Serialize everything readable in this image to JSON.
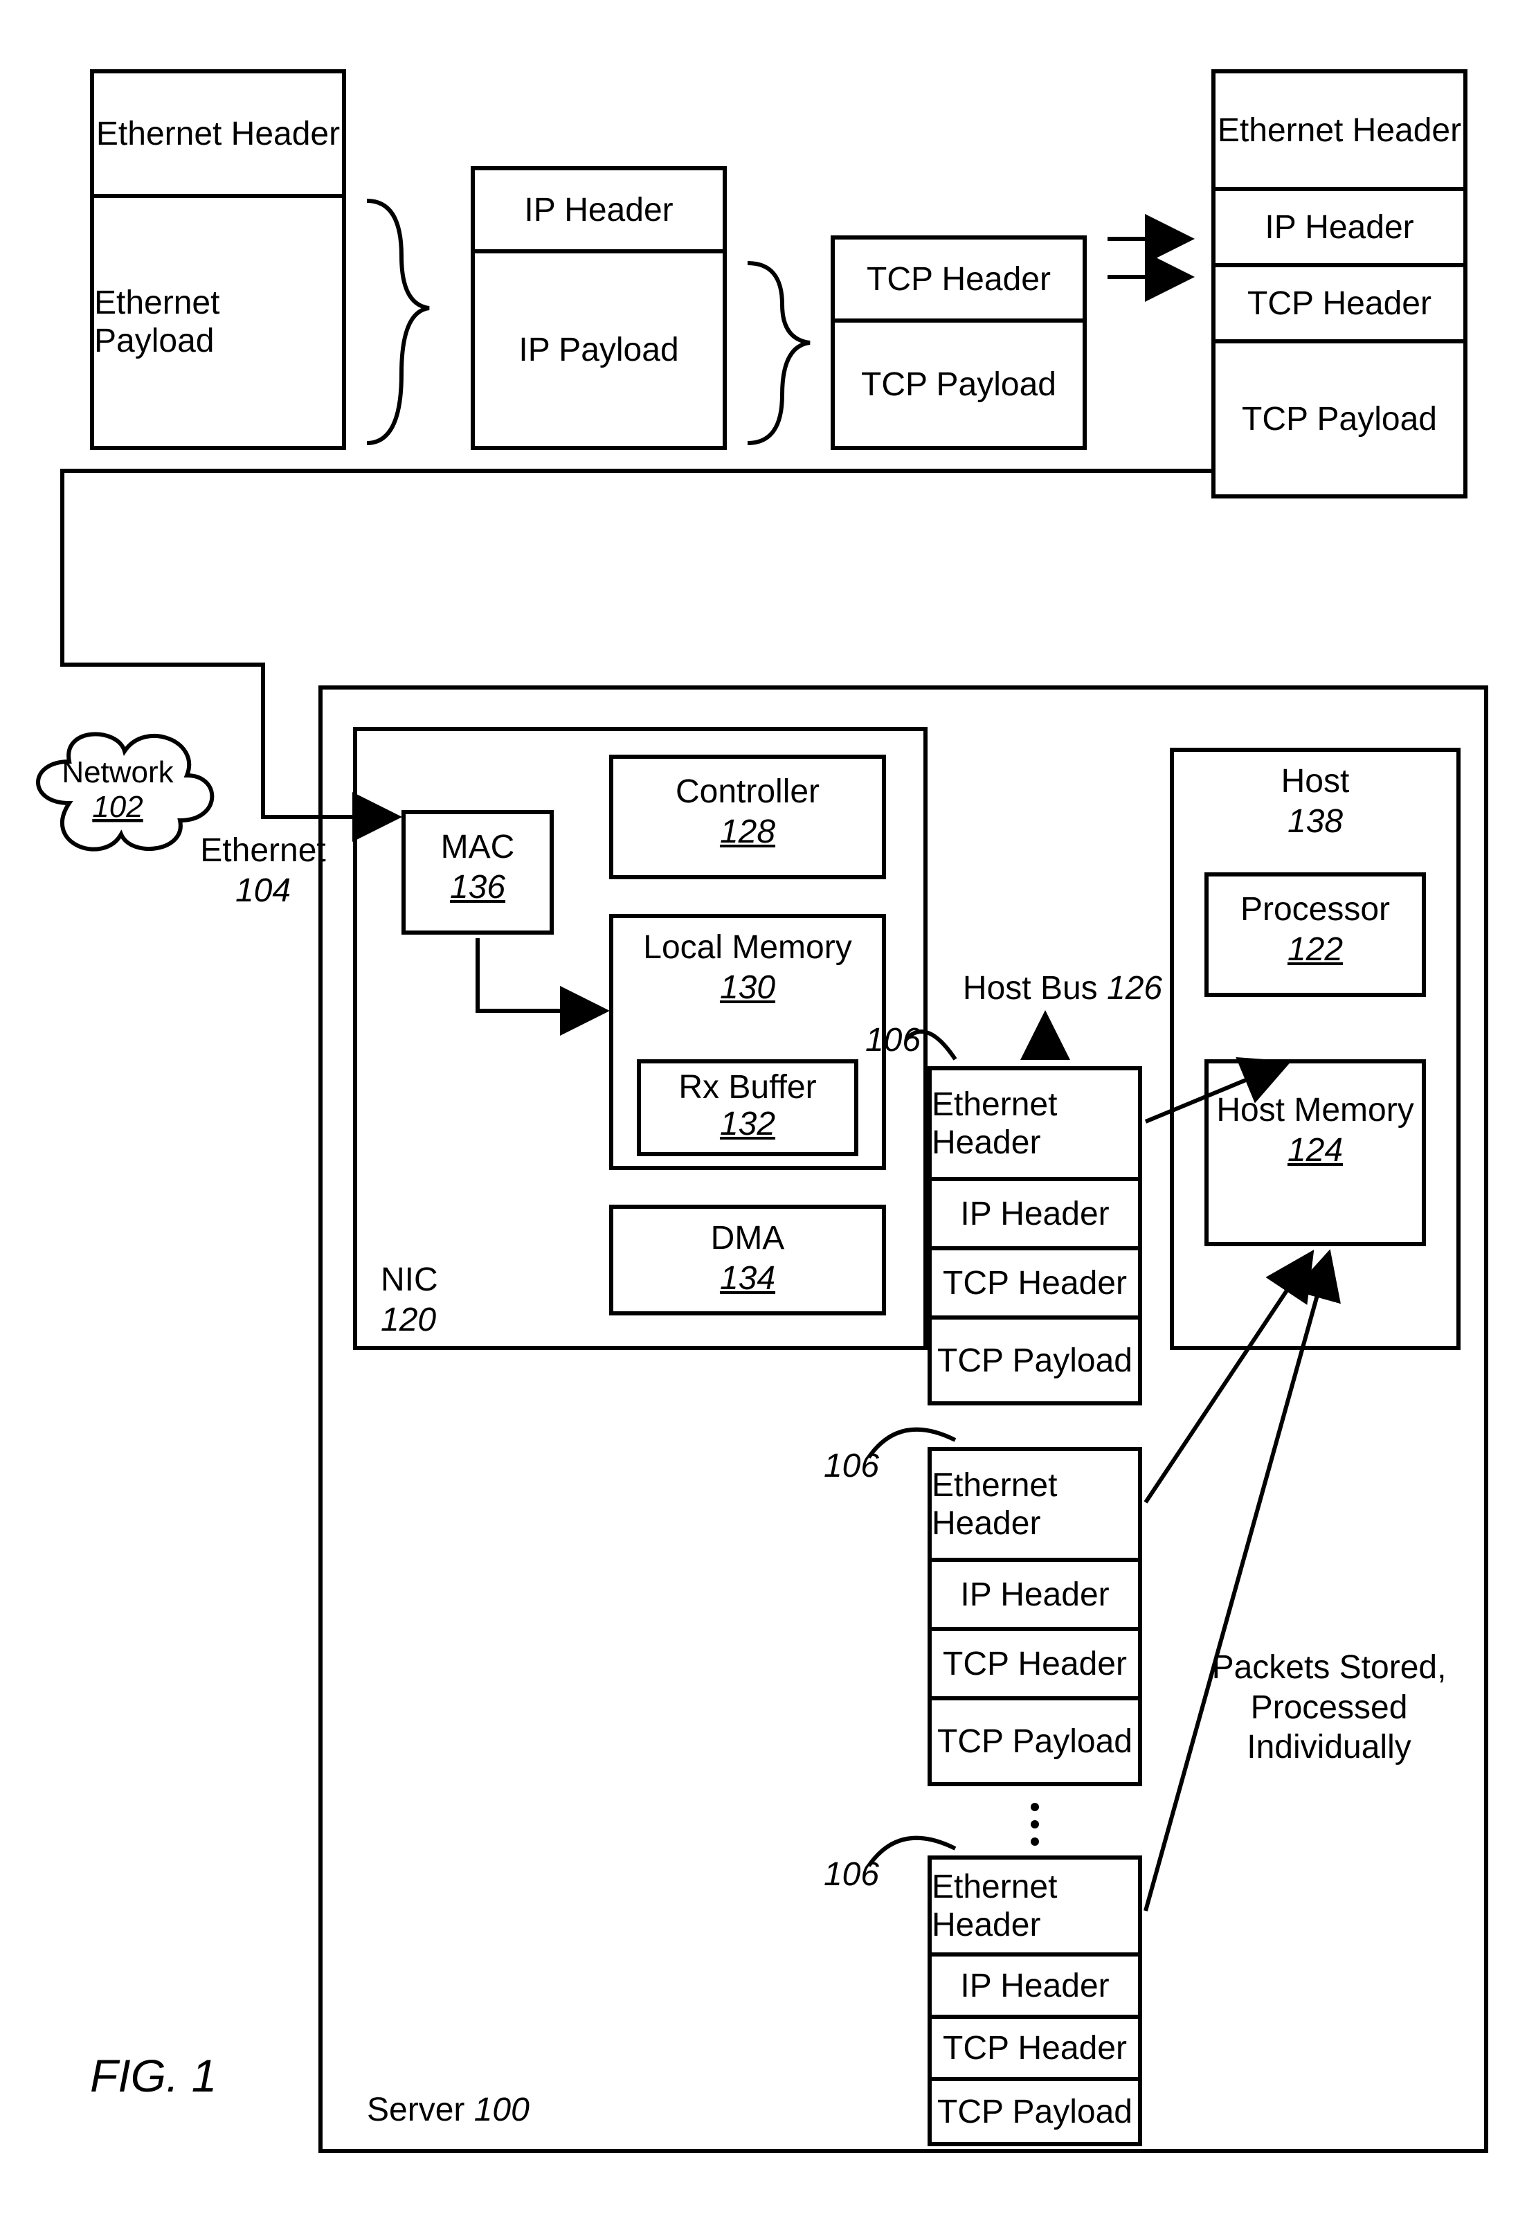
{
  "figure_label": "FIG. 1",
  "ethernet_box": {
    "header": "Ethernet Header",
    "payload": "Ethernet Payload"
  },
  "ip_box": {
    "header": "IP Header",
    "payload": "IP Payload"
  },
  "tcp_box": {
    "header": "TCP Header",
    "payload": "TCP Payload"
  },
  "combined_box": {
    "eth": "Ethernet Header",
    "ip": "IP Header",
    "tcp": "TCP Header",
    "payload": "TCP Payload"
  },
  "network": {
    "label": "Network",
    "num": "102"
  },
  "ethernet_link": {
    "label": "Ethernet",
    "num": "104"
  },
  "server": {
    "label": "Server",
    "num": "100"
  },
  "nic": {
    "label": "NIC",
    "num": "120"
  },
  "mac": {
    "label": "MAC",
    "num": "136"
  },
  "controller": {
    "label": "Controller",
    "num": "128"
  },
  "local_memory": {
    "label": "Local Memory",
    "num": "130"
  },
  "rx_buffer": {
    "label": "Rx Buffer",
    "num": "132"
  },
  "dma": {
    "label": "DMA",
    "num": "134"
  },
  "host": {
    "label": "Host",
    "num": "138"
  },
  "processor": {
    "label": "Processor",
    "num": "122"
  },
  "host_memory": {
    "label": "Host Memory",
    "num": "124"
  },
  "host_bus": {
    "label": "Host Bus",
    "num": "126"
  },
  "packet_label": "106",
  "packets_note": {
    "line1": "Packets Stored,",
    "line2": "Processed",
    "line3": "Individually"
  },
  "packet": {
    "eth": "Ethernet Header",
    "ip": "IP Header",
    "tcp": "TCP Header",
    "payload": "TCP Payload"
  }
}
